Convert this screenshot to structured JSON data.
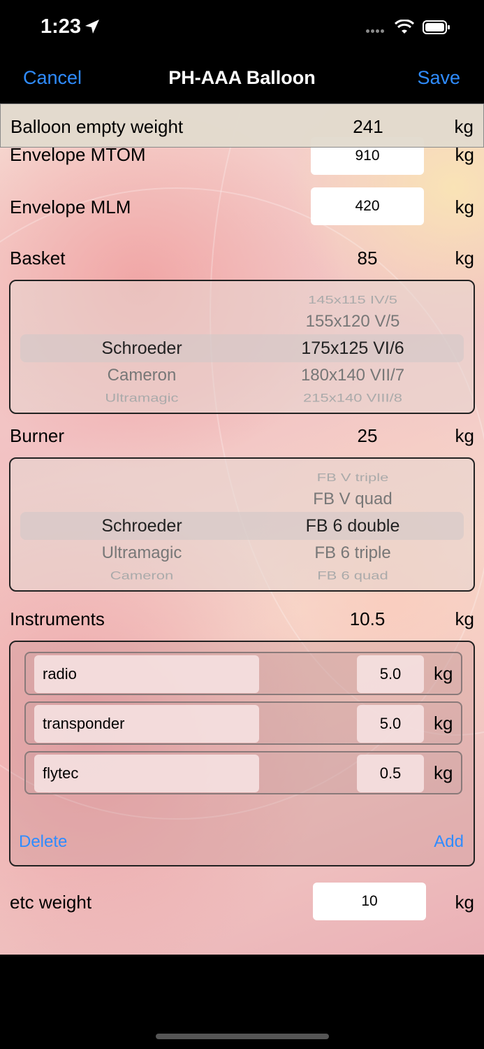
{
  "status": {
    "time": "1:23"
  },
  "nav": {
    "cancel": "Cancel",
    "title": "PH-AAA Balloon",
    "save": "Save"
  },
  "empty_weight": {
    "label": "Balloon empty weight",
    "value": "241",
    "unit": "kg"
  },
  "envelope_mtom": {
    "label": "Envelope MTOM",
    "value": "910",
    "unit": "kg"
  },
  "envelope_mlm": {
    "label": "Envelope MLM",
    "value": "420",
    "unit": "kg"
  },
  "basket": {
    "label": "Basket",
    "value": "85",
    "unit": "kg",
    "col1": [
      "Schroeder",
      "Cameron",
      "Ultramagic"
    ],
    "col2": [
      "145x115 IV/5",
      "155x120 V/5",
      "175x125 VI/6",
      "180x140 VII/7",
      "215x140 VIII/8"
    ]
  },
  "burner": {
    "label": "Burner",
    "value": "25",
    "unit": "kg",
    "col1": [
      "Schroeder",
      "Ultramagic",
      "Cameron"
    ],
    "col2": [
      "FB V triple",
      "FB V quad",
      "FB 6 double",
      "FB 6 triple",
      "FB 6 quad"
    ]
  },
  "instruments": {
    "label": "Instruments",
    "value": "10.5",
    "unit": "kg",
    "items": [
      {
        "name": "radio",
        "weight": "5.0",
        "unit": "kg"
      },
      {
        "name": "transponder",
        "weight": "5.0",
        "unit": "kg"
      },
      {
        "name": "flytec",
        "weight": "0.5",
        "unit": "kg"
      }
    ],
    "delete": "Delete",
    "add": "Add"
  },
  "etc": {
    "label": "etc weight",
    "value": "10",
    "unit": "kg"
  }
}
